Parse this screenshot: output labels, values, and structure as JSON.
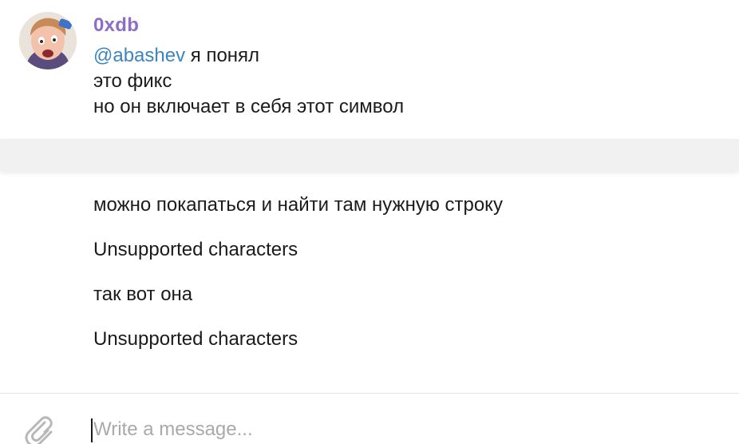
{
  "message": {
    "author": "0xdb",
    "mention": "@abashev",
    "line1_rest": " я понял",
    "line2": "это фикс",
    "line3": "но он включает в себя этот символ"
  },
  "continued_messages": [
    "можно покапаться и найти там нужную строку",
    "Unsupported characters",
    "так вот она",
    "Unsupported characters"
  ],
  "composer": {
    "placeholder": "Write a message...",
    "value": ""
  },
  "colors": {
    "author": "#8e6cc9",
    "mention": "#3c85c4",
    "separator": "#f1f1f1",
    "icon": "#b8b8b8"
  }
}
